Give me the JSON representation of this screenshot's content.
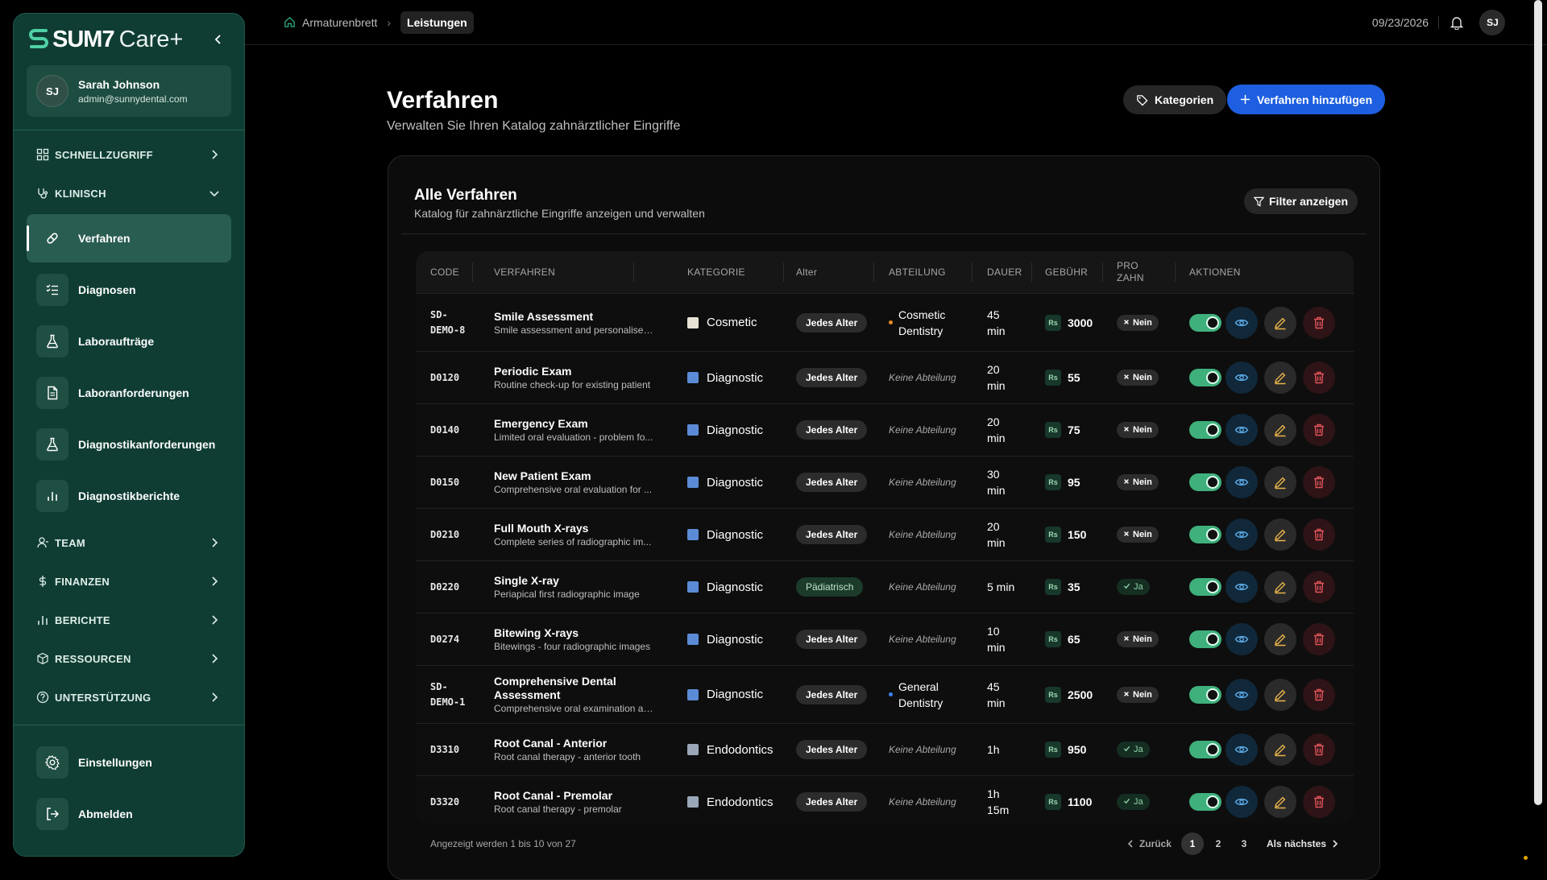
{
  "brand": {
    "name": "SUM7",
    "suffix": "Care+"
  },
  "user": {
    "initials": "SJ",
    "name": "Sarah Johnson",
    "email": "admin@sunnydental.com"
  },
  "sidebar": {
    "groups": {
      "quick": "SCHNELLZUGRIFF",
      "clinical": "KLINISCH",
      "team": "TEAM",
      "finance": "FINANZEN",
      "reports": "BERICHTE",
      "resources": "RESSOURCEN",
      "support": "UNTERSTÜTZUNG"
    },
    "items": [
      {
        "label": "Verfahren",
        "icon": "pill-icon"
      },
      {
        "label": "Diagnosen",
        "icon": "list-check-icon"
      },
      {
        "label": "Laboraufträge",
        "icon": "flask-icon"
      },
      {
        "label": "Laboranforderungen",
        "icon": "document-icon"
      },
      {
        "label": "Diagnostikanforderungen",
        "icon": "flask-icon"
      },
      {
        "label": "Diagnostikberichte",
        "icon": "bar-chart-icon"
      }
    ],
    "settings": "Einstellungen",
    "logout": "Abmelden"
  },
  "breadcrumb": {
    "home": "Armaturenbrett",
    "current": "Leistungen"
  },
  "topbar": {
    "date": "09/23/2026",
    "avatar": "SJ"
  },
  "page": {
    "title": "Verfahren",
    "subtitle": "Verwalten Sie Ihren Katalog zahnärztlicher Eingriffe",
    "categories_button": "Kategorien",
    "add_button": "Verfahren hinzufügen"
  },
  "card": {
    "title": "Alle Verfahren",
    "subtitle": "Katalog für zahnärztliche Eingriffe anzeigen und verwalten",
    "filter_button": "Filter anzeigen"
  },
  "table": {
    "headers": {
      "code": "CODE",
      "procedure": "VERFAHREN",
      "category": "KATEGORIE",
      "age": "Alter",
      "department": "ABTEILUNG",
      "duration": "DAUER",
      "fee": "GEBÜHR",
      "per_tooth_1": "PRO",
      "per_tooth_2": "ZAHN",
      "actions": "AKTIONEN"
    },
    "currency": "Rs",
    "rows": [
      {
        "code1": "SD-",
        "code2": "DEMO-8",
        "name": "Smile Assessment",
        "desc": "Smile assessment and personalised ...",
        "category": "Cosmetic",
        "cat_color": "#e8e2d6",
        "age": "Jedes Alter",
        "age_kind": "any",
        "dept1": "Cosmetic",
        "dept2": "Dentistry",
        "dept_color": "#f08a24",
        "dur1": "45",
        "dur2": "min",
        "fee": "3000",
        "per_tooth": "Nein",
        "yes": false
      },
      {
        "code1": "D0120",
        "code2": "",
        "name": "Periodic Exam",
        "desc": "Routine check-up for existing patient",
        "category": "Diagnostic",
        "cat_color": "#5b8bd6",
        "age": "Jedes Alter",
        "age_kind": "any",
        "dept1": "Keine Abteilung",
        "dept2": "",
        "dept_color": "",
        "dur1": "20",
        "dur2": "min",
        "fee": "55",
        "per_tooth": "Nein",
        "yes": false
      },
      {
        "code1": "D0140",
        "code2": "",
        "name": "Emergency Exam",
        "desc": "Limited oral evaluation - problem fo...",
        "category": "Diagnostic",
        "cat_color": "#5b8bd6",
        "age": "Jedes Alter",
        "age_kind": "any",
        "dept1": "Keine Abteilung",
        "dept2": "",
        "dept_color": "",
        "dur1": "20",
        "dur2": "min",
        "fee": "75",
        "per_tooth": "Nein",
        "yes": false
      },
      {
        "code1": "D0150",
        "code2": "",
        "name": "New Patient Exam",
        "desc": "Comprehensive oral evaluation for ...",
        "category": "Diagnostic",
        "cat_color": "#5b8bd6",
        "age": "Jedes Alter",
        "age_kind": "any",
        "dept1": "Keine Abteilung",
        "dept2": "",
        "dept_color": "",
        "dur1": "30",
        "dur2": "min",
        "fee": "95",
        "per_tooth": "Nein",
        "yes": false
      },
      {
        "code1": "D0210",
        "code2": "",
        "name": "Full Mouth X-rays",
        "desc": "Complete series of radiographic im...",
        "category": "Diagnostic",
        "cat_color": "#5b8bd6",
        "age": "Jedes Alter",
        "age_kind": "any",
        "dept1": "Keine Abteilung",
        "dept2": "",
        "dept_color": "",
        "dur1": "20",
        "dur2": "min",
        "fee": "150",
        "per_tooth": "Nein",
        "yes": false
      },
      {
        "code1": "D0220",
        "code2": "",
        "name": "Single X-ray",
        "desc": "Periapical first radiographic image",
        "category": "Diagnostic",
        "cat_color": "#5b8bd6",
        "age": "Pädiatrisch",
        "age_kind": "pediatric",
        "dept1": "Keine Abteilung",
        "dept2": "",
        "dept_color": "",
        "dur1": "5 min",
        "dur2": "",
        "fee": "35",
        "per_tooth": "Ja",
        "yes": true
      },
      {
        "code1": "D0274",
        "code2": "",
        "name": "Bitewing X-rays",
        "desc": "Bitewings - four radiographic images",
        "category": "Diagnostic",
        "cat_color": "#5b8bd6",
        "age": "Jedes Alter",
        "age_kind": "any",
        "dept1": "Keine Abteilung",
        "dept2": "",
        "dept_color": "",
        "dur1": "10",
        "dur2": "min",
        "fee": "65",
        "per_tooth": "Nein",
        "yes": false
      },
      {
        "code1": "SD-",
        "code2": "DEMO-1",
        "name": "Comprehensive Dental",
        "name2": "Assessment",
        "desc": "Comprehensive oral examination an...",
        "category": "Diagnostic",
        "cat_color": "#5b8bd6",
        "age": "Jedes Alter",
        "age_kind": "any",
        "dept1": "General",
        "dept2": "Dentistry",
        "dept_color": "#3b82f6",
        "dur1": "45",
        "dur2": "min",
        "fee": "2500",
        "per_tooth": "Nein",
        "yes": false
      },
      {
        "code1": "D3310",
        "code2": "",
        "name": "Root Canal - Anterior",
        "desc": "Root canal therapy - anterior tooth",
        "category": "Endodontics",
        "cat_color": "#9aa7b8",
        "age": "Jedes Alter",
        "age_kind": "any",
        "dept1": "Keine Abteilung",
        "dept2": "",
        "dept_color": "",
        "dur1": "1h",
        "dur2": "",
        "fee": "950",
        "per_tooth": "Ja",
        "yes": true
      },
      {
        "code1": "D3320",
        "code2": "",
        "name": "Root Canal - Premolar",
        "desc": "Root canal therapy - premolar",
        "category": "Endodontics",
        "cat_color": "#9aa7b8",
        "age": "Jedes Alter",
        "age_kind": "any",
        "dept1": "Keine Abteilung",
        "dept2": "",
        "dept_color": "",
        "dur1": "1h",
        "dur2": "15m",
        "fee": "1100",
        "per_tooth": "Ja",
        "yes": true
      }
    ]
  },
  "footer": {
    "showing": "Angezeigt werden 1 bis 10 von 27",
    "prev": "Zurück",
    "next": "Als nächstes",
    "pages": [
      "1",
      "2",
      "3"
    ]
  },
  "colors": {
    "sidebar": "#0f3d33",
    "accent": "#1d5fe0",
    "toggle": "#3fb07c"
  }
}
